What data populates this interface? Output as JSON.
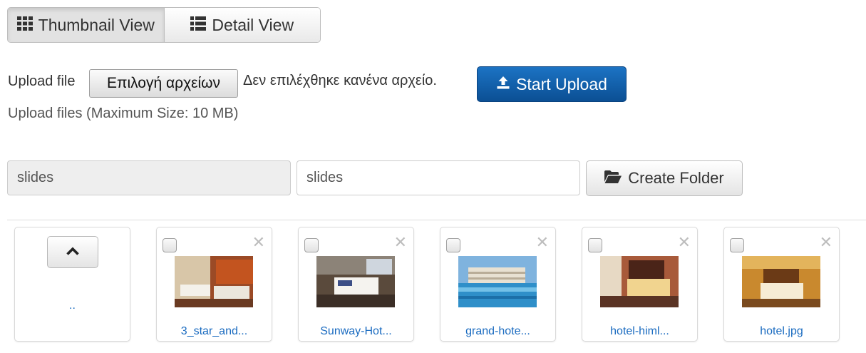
{
  "view_toggle": {
    "thumbnail_label": "Thumbnail View",
    "detail_label": "Detail View",
    "active": "thumbnail"
  },
  "upload": {
    "label": "Upload file",
    "choose_button": "Επιλογή αρχείων",
    "no_file_text": "Δεν επιλέχθηκε κανένα αρχείο.",
    "start_button": "Start Upload",
    "max_size_text": "Upload files (Maximum Size: 10 MB)"
  },
  "folder": {
    "current_path": "slides",
    "new_folder_value": "slides",
    "create_button": "Create Folder"
  },
  "tiles": {
    "up_label": "..",
    "files": [
      {
        "name": "3_star_and..."
      },
      {
        "name": "Sunway-Hot..."
      },
      {
        "name": "grand-hote..."
      },
      {
        "name": "hotel-himl..."
      },
      {
        "name": "hotel.jpg"
      }
    ]
  },
  "colors": {
    "accent": "#0b5aa8",
    "link": "#1a6bc0"
  }
}
